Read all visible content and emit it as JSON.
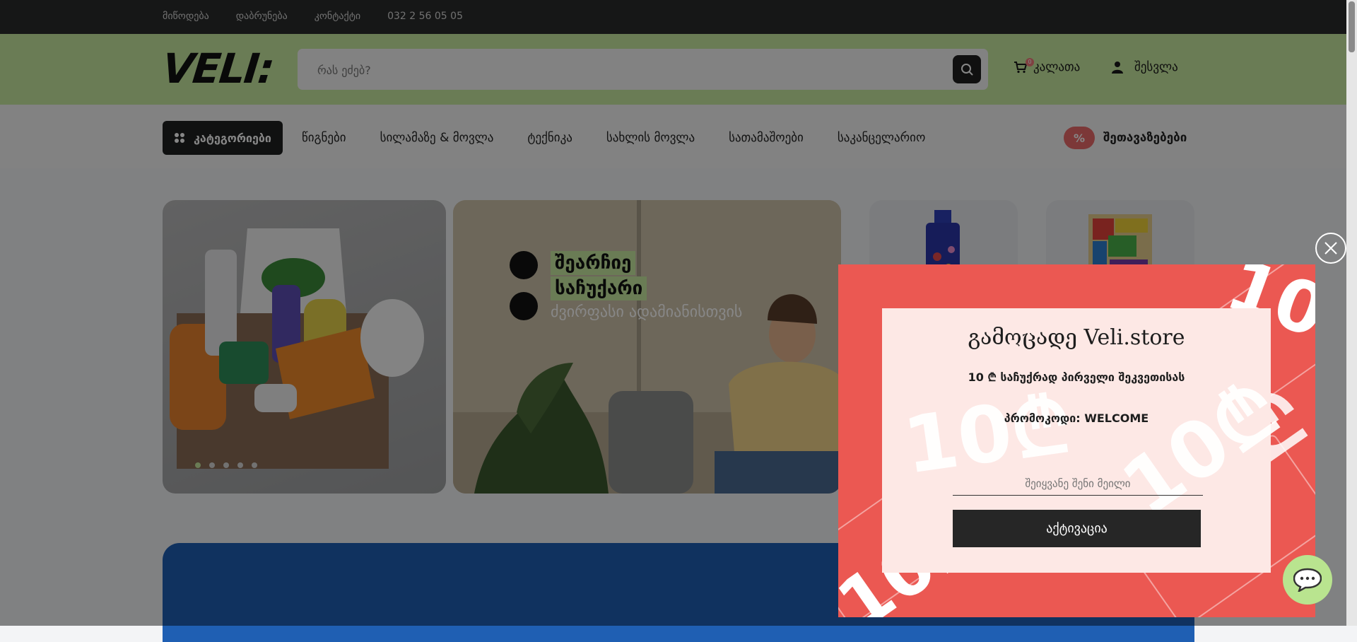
{
  "topbar": {
    "links": [
      "მიწოდება",
      "დაბრუნება",
      "კონტაქტი",
      "032 2 56 05 05"
    ]
  },
  "header": {
    "logo": "VELI:",
    "search_placeholder": "რას ეძებ?",
    "cart_label": "კალათა",
    "cart_count": "0",
    "login_label": "შესვლა"
  },
  "nav": {
    "categories_label": "კატეგორიები",
    "items": [
      "წიგნები",
      "სილამაზე & მოვლა",
      "ტექნიკა",
      "სახლის მოვლა",
      "სათამაშოები",
      "საკანცელარიო"
    ],
    "offers_label": "შეთავაზებები",
    "offers_badge": "%"
  },
  "banner2": {
    "line1": "შეარჩიე",
    "line2": "საჩუქარი",
    "line3": "ძვირფასი ადამიანისთვის"
  },
  "popup": {
    "title": "გამოცადე Veli.store",
    "subtitle": "10 ₾ საჩუქრად პირველი შეკვეთისას",
    "promo": "პრომოკოდი: WELCOME",
    "email_placeholder": "შეიყვანე შენი მეილი",
    "button_label": "აქტივაცია",
    "deco_text": "10₾"
  },
  "colors": {
    "accent_green": "#c8eaa0",
    "popup_red": "#eb5852",
    "dark": "#262626"
  }
}
